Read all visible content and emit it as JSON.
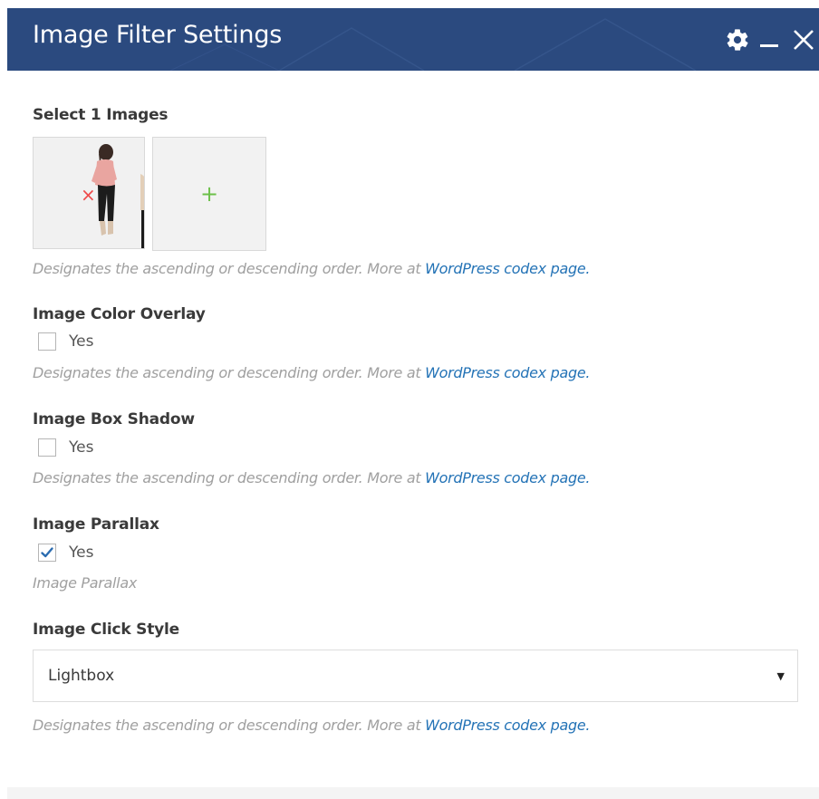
{
  "window": {
    "title": "Image Filter Settings"
  },
  "header_tools": {
    "gear_icon": "gear-icon",
    "minimize_icon": "minimize-icon",
    "close_icon": "close-icon"
  },
  "colors": {
    "header_bg": "#2b4a7f",
    "link": "#2473b6",
    "add_plus": "#6cc04a",
    "remove_x": "#ef4a4a",
    "check_mark": "#2b6cb0"
  },
  "images_section": {
    "label": "Select 1 Images",
    "add_symbol": "+",
    "remove_symbol": "×",
    "desc_prefix": "Designates the ascending or descending order. More at ",
    "desc_link": "WordPress codex page."
  },
  "color_overlay": {
    "label": "Image Color Overlay",
    "option": "Yes",
    "checked": false,
    "desc_prefix": "Designates the ascending or descending order. More at ",
    "desc_link": "WordPress codex page."
  },
  "box_shadow": {
    "label": "Image Box Shadow",
    "option": "Yes",
    "checked": false,
    "desc_prefix": "Designates the ascending or descending order. More at ",
    "desc_link": "WordPress codex page."
  },
  "parallax": {
    "label": "Image Parallax",
    "option": "Yes",
    "checked": true,
    "desc": "Image Parallax"
  },
  "click_style": {
    "label": "Image Click Style",
    "selected": "Lightbox",
    "desc_prefix": "Designates the ascending or descending order. More at ",
    "desc_link": "WordPress codex page."
  }
}
